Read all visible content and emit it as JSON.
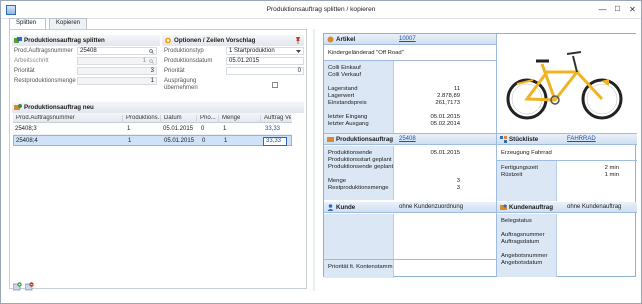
{
  "window": {
    "title": "Produktionsauftrag splitten / kopieren",
    "minimize": "—",
    "maximize": "☐",
    "close": "✕"
  },
  "tabs": [
    {
      "label": "Splitten"
    },
    {
      "label": "Kopieren"
    }
  ],
  "split_group": {
    "title": "Produktionsauftrag splitten",
    "fields": [
      {
        "label": "Prod.Auftragsnummer",
        "value": "25408"
      },
      {
        "label": "Arbeitsschritt",
        "value": "1"
      },
      {
        "label": "Priorität",
        "value": "3"
      },
      {
        "label": "Restproduktionsmenge",
        "value": "1"
      }
    ]
  },
  "options_group": {
    "title": "Optionen / Zeilen Vorschlag",
    "fields": [
      {
        "label": "Produktionstyp",
        "value": "1 Startproduktion"
      },
      {
        "label": "Produktionsdatum",
        "value": "05.01.2015"
      },
      {
        "label": "Priorität",
        "value": "0"
      },
      {
        "label": "Ausprägung",
        "label2": "übernehmen",
        "value": ""
      }
    ]
  },
  "new_group": {
    "title": "Produktionsauftrag neu",
    "columns": [
      "Prod.Auftragsnummer",
      "Produktions...",
      "Datum",
      "Prio...",
      "Menge",
      "Auftrag Verha..."
    ],
    "rows": [
      {
        "nr": "25408;3",
        "prod": "1",
        "datum": "05.01.2015",
        "prio": "0",
        "menge": "1",
        "verh": "33,33"
      },
      {
        "nr": "25408;4",
        "prod": "1",
        "datum": "05.01.2015",
        "prio": "0",
        "menge": "1",
        "verh": "33,33"
      }
    ]
  },
  "artikel": {
    "label": "Artikel",
    "number": "10007",
    "name": "Kindergeländerad \"Off Road\"",
    "rows_left": [
      "Colli Einkauf",
      "Colli Verkauf",
      "",
      "Lagerstand",
      "Lagerwert",
      "Einstandspreis",
      "",
      "letzter Eingang",
      "letzter Ausgang"
    ],
    "rows_right": [
      "",
      "",
      "",
      "11",
      "2.878,89",
      "261,7173",
      "",
      "05.01.2015",
      "05.02.2014"
    ]
  },
  "produktionsauftrag": {
    "label": "Produktionsauftrag",
    "number": "25408",
    "rows_left": [
      "Produktionsende",
      "Produktionsstart geplant",
      "Produktionsende geplant",
      "",
      "Menge",
      "Restproduktionsmenge"
    ],
    "rows_right": [
      "05.01.2015",
      "",
      "",
      "",
      "3",
      "3"
    ]
  },
  "stueckliste": {
    "label": "Stückliste",
    "link": "FAHRRAD",
    "subtitle": "Erzeugung Fahrrad",
    "rows_left": [
      "Fertigungszeit",
      "Rüstzeit"
    ],
    "rows_right": [
      "2 min",
      "1 min"
    ]
  },
  "kunde": {
    "label": "Kunde",
    "value": "ohne Kundenzuordnung",
    "footer": "Priorität lt. Kontenstamm"
  },
  "kundenauftrag": {
    "label": "Kundenauftrag",
    "value": "ohne Kundenauftrag",
    "rows": [
      "Belegstatus",
      "",
      "Auftragsnummer",
      "Auftragsdatum",
      "",
      "Angebotsnummer",
      "Angebotsdatum"
    ]
  },
  "colors": {
    "accent": "#1f4fa5",
    "section_header": "#cfdff2",
    "label_column": "#dbe7f5",
    "selection": "#cfe2f7",
    "bike_frame": "#f0b323"
  },
  "icons": [
    "app-icon",
    "search-icon",
    "pin-icon",
    "split-icon",
    "options-icon",
    "new-order-icon",
    "add-row-icon",
    "delete-row-icon",
    "artikel-icon",
    "production-icon",
    "bom-icon",
    "customer-icon",
    "customer-order-icon"
  ]
}
